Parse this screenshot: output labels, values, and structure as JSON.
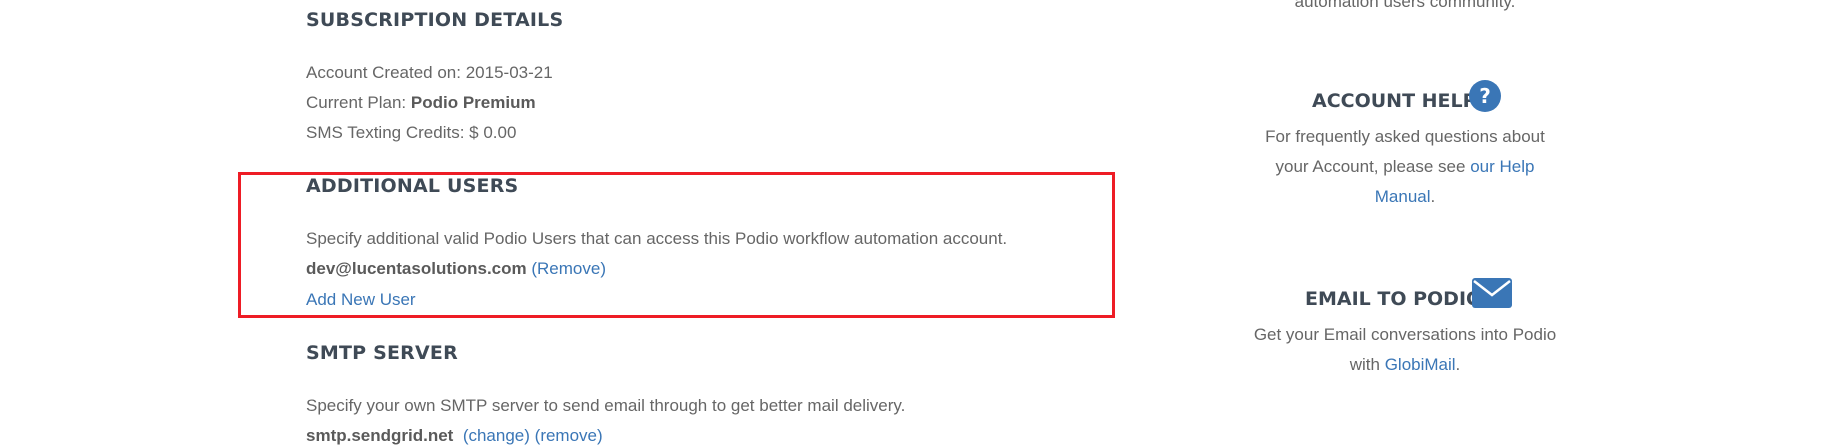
{
  "subscription": {
    "heading": "SUBSCRIPTION DETAILS",
    "created_label": "Account Created on:",
    "created_value": "2015-03-21",
    "plan_label": "Current Plan:",
    "plan_value": "Podio Premium",
    "sms_label": "SMS Texting Credits:",
    "sms_value": "$ 0.00"
  },
  "additional_users": {
    "heading": "ADDITIONAL USERS",
    "description": "Specify additional valid Podio Users that can access this Podio workflow automation account.",
    "user_email": "dev@lucentasolutions.com",
    "remove_label": "(Remove)",
    "add_label": "Add New User"
  },
  "smtp": {
    "heading": "SMTP SERVER",
    "description": "Specify your own SMTP server to send email through to get better mail delivery.",
    "server": "smtp.sendgrid.net",
    "change_label": "(change)",
    "remove_label": "(remove)"
  },
  "sidebar": {
    "top_fragment": "automation users community.",
    "account_help": {
      "heading": "ACCOUNT HELP",
      "line1": "For frequently asked questions about",
      "line2_prefix": "your Account, please see",
      "link_part1": "our Help",
      "link_part2": "Manual",
      "suffix": ".",
      "icon": "question-circle-icon"
    },
    "email_to_podio": {
      "heading": "EMAIL TO PODIO",
      "line1": "Get your Email conversations into Podio",
      "line2_prefix": "with",
      "link": "GlobiMail",
      "suffix": ".",
      "icon": "envelope-icon"
    }
  },
  "colors": {
    "link": "#3a76b6",
    "heading": "#3f4a56",
    "highlight": "#ee1c25",
    "icon": "#3a76b6"
  }
}
